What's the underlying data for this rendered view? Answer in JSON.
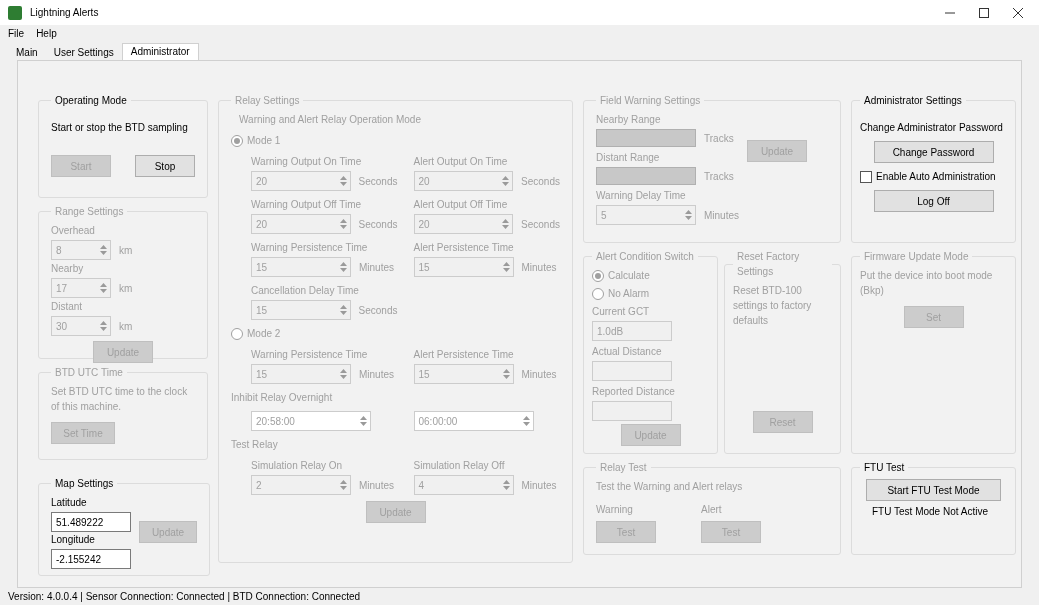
{
  "window": {
    "title": "Lightning Alerts"
  },
  "menu": [
    "File",
    "Help"
  ],
  "tabs": [
    {
      "label": "Main",
      "selected": false
    },
    {
      "label": "User Settings",
      "selected": false
    },
    {
      "label": "Administrator",
      "selected": true
    }
  ],
  "operating_mode": {
    "title": "Operating Mode",
    "disabled": false,
    "text": "Start or stop the BTD sampling",
    "buttons": [
      {
        "label": "Start",
        "disabled": true
      },
      {
        "label": "Stop",
        "disabled": false
      }
    ]
  },
  "range_settings": {
    "title": "Range Settings",
    "disabled": true,
    "fields": [
      {
        "kind": "spin",
        "label": "Overhead",
        "value": "8",
        "unit": "km"
      },
      {
        "kind": "spin",
        "label": "Nearby",
        "value": "17",
        "unit": "km"
      },
      {
        "kind": "spin",
        "label": "Distant",
        "value": "30",
        "unit": "km"
      }
    ],
    "button": {
      "label": "Update",
      "disabled": true
    }
  },
  "btd_utc_time": {
    "title": "BTD UTC Time",
    "disabled": true,
    "text": "Set BTD UTC time to the clock of this machine.",
    "button": {
      "label": "Set Time",
      "disabled": true
    }
  },
  "map_settings": {
    "title": "Map Settings",
    "disabled": false,
    "fields": [
      {
        "kind": "text",
        "label": "Latitude",
        "value": "51.489222"
      },
      {
        "kind": "text",
        "label": "Longitude",
        "value": "-2.155242"
      }
    ],
    "button": {
      "label": "Update",
      "disabled": true
    }
  },
  "relay_settings": {
    "title": "Relay Settings",
    "disabled": true,
    "subtitle": "Warning and Alert Relay Operation Mode",
    "mode_1": {
      "label": "Mode 1",
      "selected": true
    },
    "mode_1_fields": [
      {
        "kind": "spin",
        "label": "Warning Output On Time",
        "value": "20",
        "unit": "Seconds"
      },
      {
        "kind": "spin",
        "label": "Alert Output On Time",
        "value": "20",
        "unit": "Seconds"
      },
      {
        "kind": "spin",
        "label": "Warning Output Off Time",
        "value": "20",
        "unit": "Seconds"
      },
      {
        "kind": "spin",
        "label": "Alert Output Off Time",
        "value": "20",
        "unit": "Seconds"
      },
      {
        "kind": "spin",
        "label": "Warning Persistence Time",
        "value": "15",
        "unit": "Minutes"
      },
      {
        "kind": "spin",
        "label": "Alert Persistence Time",
        "value": "15",
        "unit": "Minutes"
      },
      {
        "kind": "spin",
        "label": "Cancellation Delay Time",
        "value": "15",
        "unit": "Seconds"
      }
    ],
    "mode_2": {
      "label": "Mode 2",
      "selected": false
    },
    "mode_2_fields": [
      {
        "kind": "spin",
        "label": "Warning Persistence Time",
        "value": "15",
        "unit": "Minutes"
      },
      {
        "kind": "spin",
        "label": "Alert Persistence Time",
        "value": "15",
        "unit": "Minutes"
      }
    ],
    "inhibit": {
      "label": "Inhibit Relay Overnight",
      "times": [
        "20:58:00",
        "06:00:00"
      ]
    },
    "test_relay": {
      "label": "Test Relay",
      "fields": [
        {
          "kind": "spin",
          "label": "Simulation Relay On",
          "value": "2",
          "unit": "Minutes"
        },
        {
          "kind": "spin",
          "label": "Simulation Relay Off",
          "value": "4",
          "unit": "Minutes"
        }
      ]
    },
    "button": {
      "label": "Update",
      "disabled": true
    }
  },
  "field_warning": {
    "title": "Field Warning Settings",
    "disabled": true,
    "fields": [
      {
        "kind": "bar",
        "label": "Nearby Range",
        "unit": "Tracks"
      },
      {
        "kind": "bar",
        "label": "Distant Range",
        "unit": "Tracks"
      },
      {
        "kind": "spin",
        "label": "Warning Delay Time",
        "value": "5",
        "unit": "Minutes"
      }
    ],
    "button": {
      "label": "Update",
      "disabled": true
    }
  },
  "alert_condition": {
    "title": "Alert Condition Switch",
    "disabled": true,
    "options": [
      {
        "label": "Calculate",
        "selected": true
      },
      {
        "label": "No Alarm",
        "selected": false
      }
    ],
    "fields": [
      {
        "kind": "text",
        "label": "Current GCT",
        "value": "1.0dB"
      },
      {
        "kind": "text",
        "label": "Actual Distance"
      },
      {
        "kind": "text",
        "label": "Reported Distance"
      }
    ],
    "button": {
      "label": "Update",
      "disabled": true
    }
  },
  "reset_factory": {
    "title": "Reset Factory Settings",
    "disabled": true,
    "text": "Reset BTD-100 settings to factory defaults",
    "button": {
      "label": "Reset",
      "disabled": true
    }
  },
  "relay_test": {
    "title": "Relay Test",
    "disabled": true,
    "text": "Test the Warning and Alert relays",
    "tests": [
      {
        "label": "Warning",
        "button": {
          "label": "Test",
          "disabled": true
        }
      },
      {
        "label": "Alert",
        "button": {
          "label": "Test",
          "disabled": true
        }
      }
    ]
  },
  "admin_settings": {
    "title": "Administrator Settings",
    "disabled": false,
    "text": "Change Administrator Password",
    "button": {
      "label": "Change Password",
      "disabled": false
    },
    "checkbox": {
      "label": "Enable Auto Administration",
      "checked": false
    },
    "logoff": {
      "label": "Log Off",
      "disabled": false
    }
  },
  "firmware": {
    "title": "Firmware Update Mode",
    "disabled": true,
    "text": "Put the device into boot mode (Bkp)",
    "button": {
      "label": "Set",
      "disabled": true
    }
  },
  "ftu_test": {
    "title": "FTU Test",
    "disabled": false,
    "button": {
      "label": "Start FTU Test Mode",
      "disabled": false
    },
    "status": "FTU Test Mode Not Active"
  },
  "status_bar": "Version: 4.0.0.4 | Sensor Connection: Connected | BTD Connection: Connected"
}
